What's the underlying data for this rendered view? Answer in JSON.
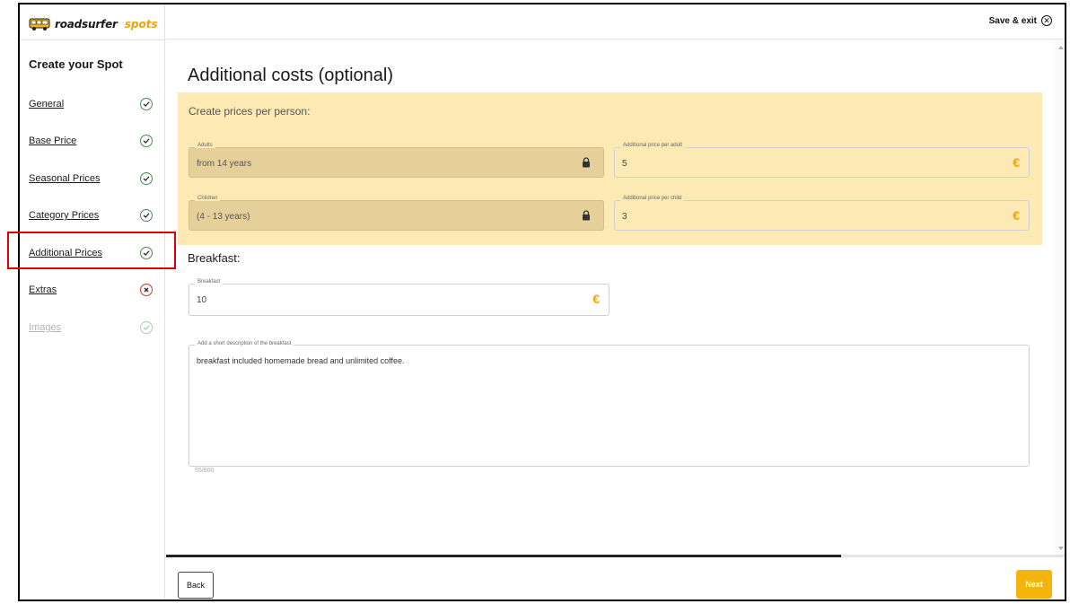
{
  "app": {
    "logo_text": "roadsurfer",
    "logo_sub": "spots",
    "save_exit_label": "Save & exit"
  },
  "sidebar": {
    "title": "Create your Spot",
    "items": [
      {
        "label": "General",
        "status": "done"
      },
      {
        "label": "Base Price",
        "status": "done"
      },
      {
        "label": "Seasonal Prices",
        "status": "done"
      },
      {
        "label": "Category Prices",
        "status": "done"
      },
      {
        "label": "Additional Prices",
        "status": "done"
      },
      {
        "label": "Extras",
        "status": "error"
      },
      {
        "label": "Images",
        "status": "disabled"
      }
    ]
  },
  "main": {
    "title": "Additional costs (optional)",
    "per_person_label": "Create prices per person:",
    "adults": {
      "label": "Adults",
      "value": "from 14 years"
    },
    "adult_price": {
      "label": "Additional price per adult",
      "value": "5",
      "suffix": "€"
    },
    "children": {
      "label": "Children",
      "value": "(4 - 13 years)"
    },
    "child_price": {
      "label": "Additional price per child",
      "value": "3",
      "suffix": "€"
    },
    "breakfast_label": "Breakfast:",
    "breakfast": {
      "label": "Breakfast",
      "value": "10",
      "suffix": "€"
    },
    "breakfast_desc": {
      "label": "Add a short description of the breakfast",
      "value": "breakfast included homemade bread and unlimited coffee."
    },
    "char_counter": "55/800"
  },
  "progress": {
    "fraction": 0.75
  },
  "footer": {
    "back_label": "Back",
    "next_label": "Next"
  },
  "colors": {
    "accent": "#f5b40b",
    "highlight_bg": "#fde9b3",
    "success": "#4a8a4a",
    "error": "#dd3333",
    "annotation": "#e10000"
  }
}
